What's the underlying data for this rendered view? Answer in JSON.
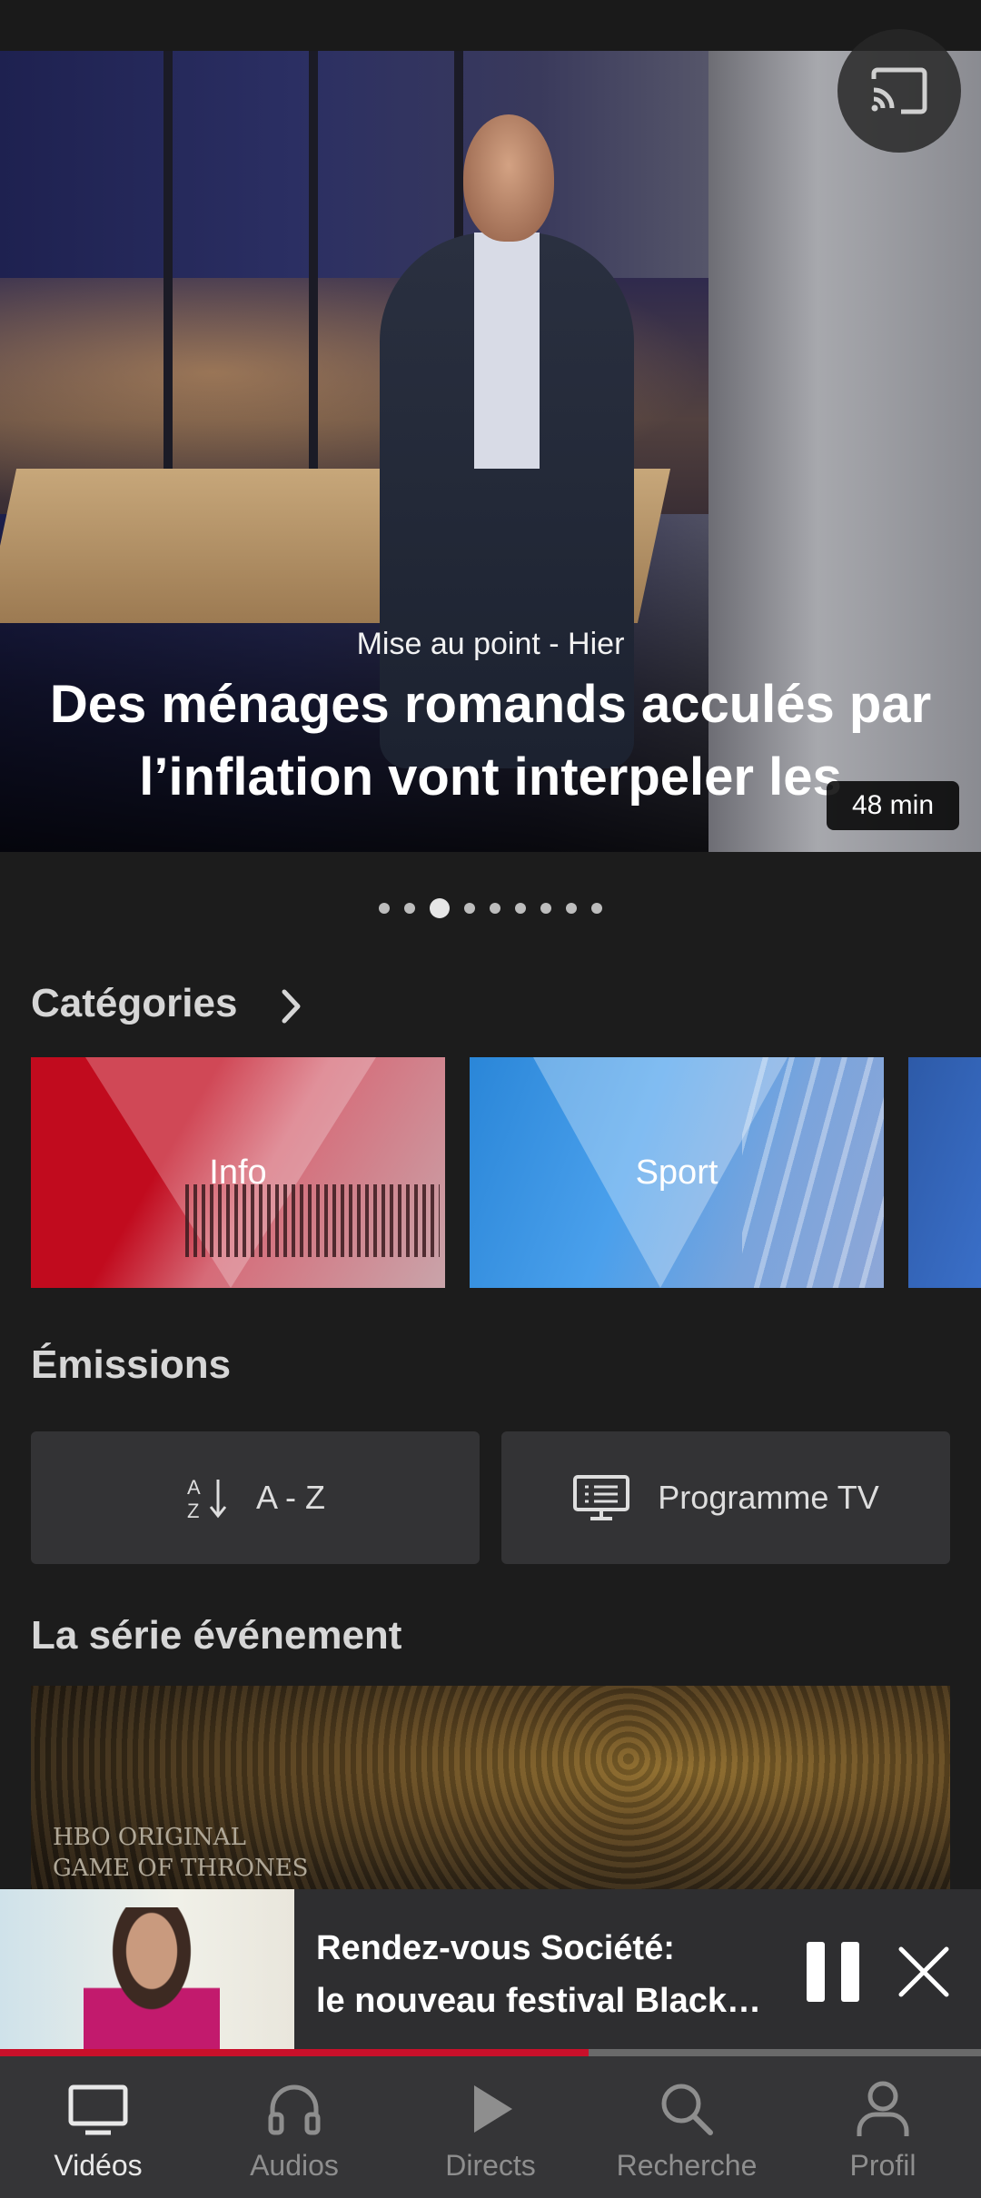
{
  "hero": {
    "subtitle": "Mise au point - Hier",
    "title": "Des ménages romands acculés par l’inflation vont interpeler les",
    "duration": "48 min",
    "slide_count": 9,
    "active_slide": 3
  },
  "sections": {
    "categories": "Catégories",
    "emissions": "Émissions",
    "series": "La série événement"
  },
  "categories": [
    {
      "label": "Info"
    },
    {
      "label": "Sport"
    }
  ],
  "emissions": {
    "az_label": "A - Z",
    "tv_label": "Programme TV"
  },
  "series_card": {
    "brand_line1": "HBO ORIGINAL",
    "brand_line2": "GAME OF THRONES"
  },
  "mini_player": {
    "line1": "Rendez-vous Société:",
    "line2": "le nouveau festival Black…",
    "progress": 0.6
  },
  "nav": {
    "items": [
      {
        "label": "Vidéos",
        "icon": "tv-icon",
        "active": true
      },
      {
        "label": "Audios",
        "icon": "headphones-icon",
        "active": false
      },
      {
        "label": "Directs",
        "icon": "play-icon",
        "active": false
      },
      {
        "label": "Recherche",
        "icon": "search-icon",
        "active": false
      },
      {
        "label": "Profil",
        "icon": "profile-icon",
        "active": false
      }
    ]
  },
  "colors": {
    "background": "#1c1c1c",
    "accent_red": "#c9102a",
    "nav_background": "#353537"
  }
}
